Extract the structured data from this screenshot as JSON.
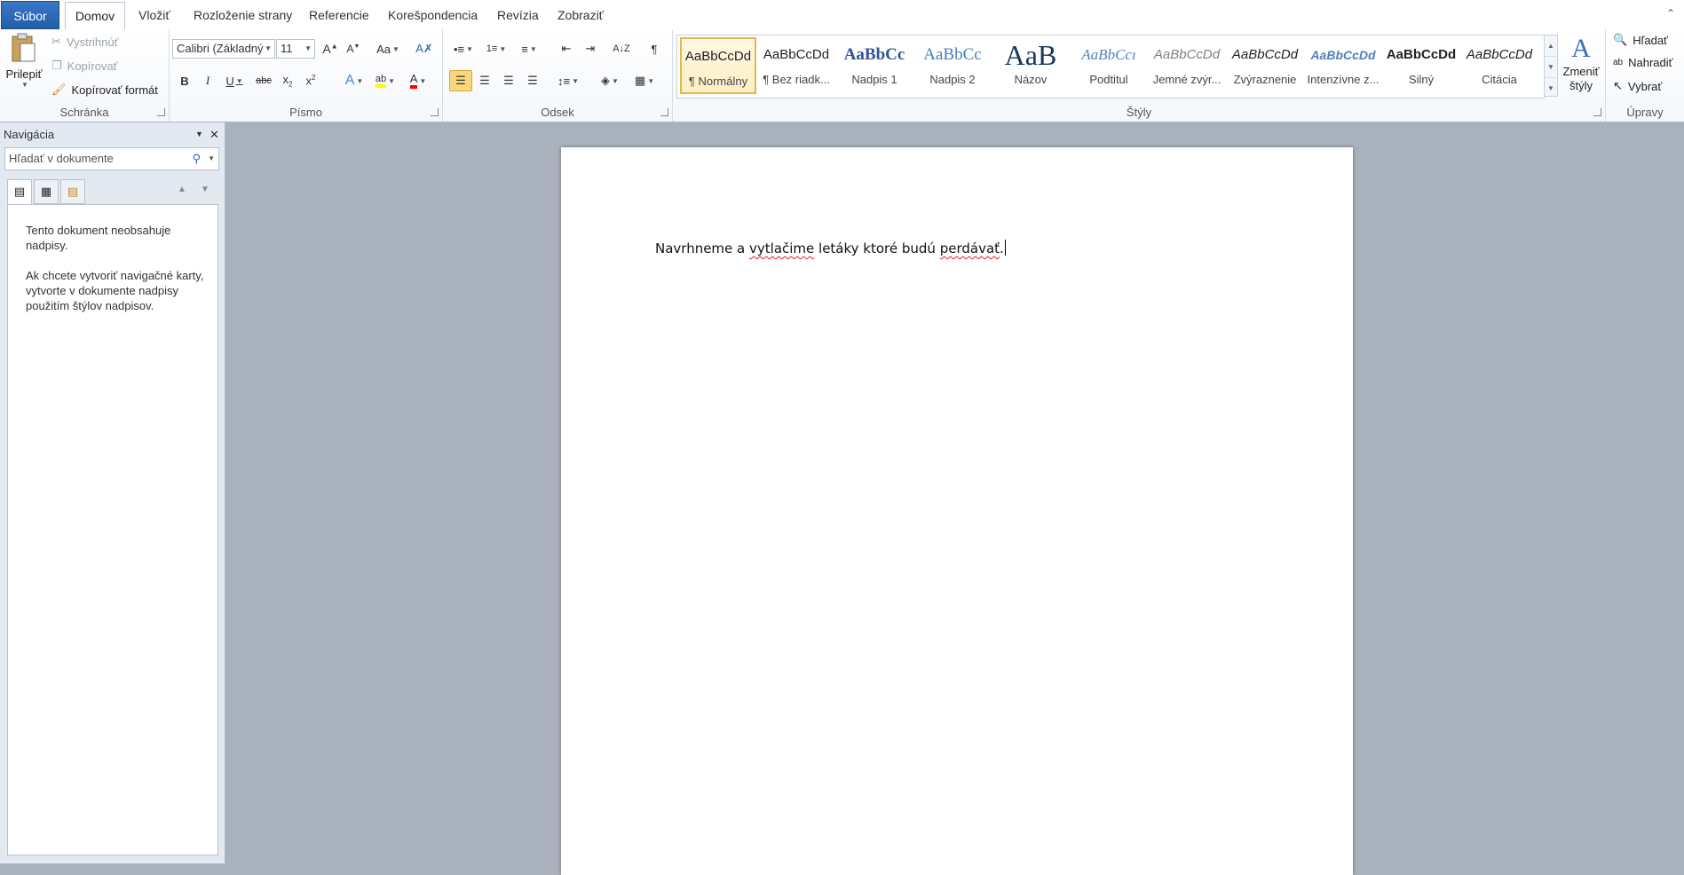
{
  "tabs": {
    "file": "Súbor",
    "home": "Domov",
    "insert": "Vložiť",
    "layout": "Rozloženie strany",
    "references": "Referencie",
    "mailings": "Korešpondencia",
    "review": "Revízia",
    "view": "Zobraziť"
  },
  "clipboard": {
    "paste": "Prilepiť",
    "cut": "Vystrihnúť",
    "copy": "Kopírovať",
    "format_painter": "Kopírovať formát",
    "group_label": "Schránka"
  },
  "font": {
    "name": "Calibri (Základný",
    "size": "11",
    "group_label": "Písmo"
  },
  "paragraph": {
    "group_label": "Odsek"
  },
  "styles": {
    "items": [
      {
        "preview": "AaBbCcDd",
        "name": "¶ Normálny"
      },
      {
        "preview": "AaBbCcDd",
        "name": "¶ Bez riadk..."
      },
      {
        "preview": "AaBbCc",
        "name": "Nadpis 1"
      },
      {
        "preview": "AaBbCc",
        "name": "Nadpis 2"
      },
      {
        "preview": "AaB",
        "name": "Názov"
      },
      {
        "preview": "AaBbCcı",
        "name": "Podtitul"
      },
      {
        "preview": "AaBbCcDd",
        "name": "Jemné zvýr..."
      },
      {
        "preview": "AaBbCcDd",
        "name": "Zvýraznenie"
      },
      {
        "preview": "AaBbCcDd",
        "name": "Intenzívne z..."
      },
      {
        "preview": "AaBbCcDd",
        "name": "Silný"
      },
      {
        "preview": "AaBbCcDd",
        "name": "Citácia"
      }
    ],
    "change_styles": "Zmeniť štýly",
    "group_label": "Štýly"
  },
  "editing": {
    "find": "Hľadať",
    "replace": "Nahradiť",
    "select": "Vybrať",
    "group_label": "Úpravy"
  },
  "nav": {
    "title": "Navigácia",
    "search_placeholder": "Hľadať v dokumente",
    "msg1": "Tento dokument neobsahuje nadpisy.",
    "msg2": "Ak chcete vytvoriť navigačné karty, vytvorte v dokumente nadpisy použitím štýlov nadpisov."
  },
  "document": {
    "text_plain1": "Navrhneme a ",
    "text_err1": "vytlačime",
    "text_plain2": " letáky ktoré budú ",
    "text_err2": "perdávať",
    "text_end": "."
  },
  "colors": {
    "file_tab": "#2a67b5",
    "highlight": "#ffff00",
    "font_color": "#ff0000",
    "selected_style_border": "#e7b54c"
  }
}
